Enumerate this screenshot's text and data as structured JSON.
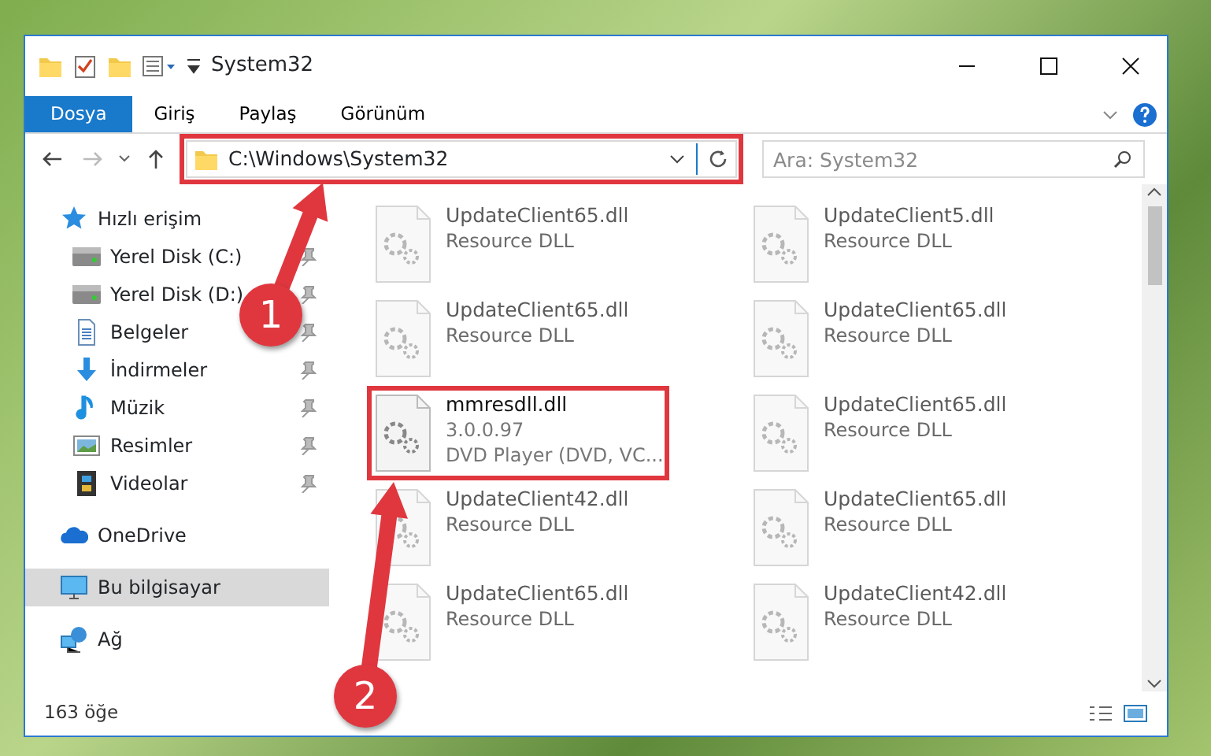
{
  "window": {
    "title": "System32"
  },
  "ribbon_tabs": [
    {
      "label": "Dosya",
      "selected": true
    },
    {
      "label": "Giriş",
      "selected": false
    },
    {
      "label": "Paylaş",
      "selected": false
    },
    {
      "label": "Görünüm",
      "selected": false
    }
  ],
  "address": {
    "path": "C:\\Windows\\System32"
  },
  "search": {
    "placeholder": "Ara: System32"
  },
  "sidebar": {
    "items": [
      {
        "label": "Hızlı erişim",
        "kind": "star",
        "selected": false,
        "children": [
          {
            "label": "Yerel Disk (C:)",
            "kind": "drive",
            "pinned": true
          },
          {
            "label": "Yerel Disk (D:)",
            "kind": "drive",
            "pinned": true
          },
          {
            "label": "Belgeler",
            "kind": "doc",
            "pinned": true
          },
          {
            "label": "İndirmeler",
            "kind": "download",
            "pinned": true
          },
          {
            "label": "Müzik",
            "kind": "music",
            "pinned": true
          },
          {
            "label": "Resimler",
            "kind": "picture",
            "pinned": true
          },
          {
            "label": "Videolar",
            "kind": "video",
            "pinned": true
          }
        ]
      },
      {
        "label": "OneDrive",
        "kind": "cloud",
        "selected": false
      },
      {
        "label": "Bu bilgisayar",
        "kind": "pc",
        "selected": true
      },
      {
        "label": "Ağ",
        "kind": "network",
        "selected": false
      }
    ]
  },
  "files": [
    {
      "name": "UpdateClient65.dll",
      "details": [
        "Resource DLL"
      ],
      "blurred": true
    },
    {
      "name": "UpdateClient5.dll",
      "details": [
        "Resource DLL"
      ],
      "blurred": true
    },
    {
      "name": "UpdateClient65.dll",
      "details": [
        "Resource DLL"
      ],
      "blurred": true
    },
    {
      "name": "UpdateClient65.dll",
      "details": [
        "Resource DLL"
      ],
      "blurred": true
    },
    {
      "name": "mmresdll.dll",
      "details": [
        "3.0.0.97",
        "DVD Player (DVD, VC..."
      ],
      "blurred": false
    },
    {
      "name": "UpdateClient65.dll",
      "details": [
        "Resource DLL"
      ],
      "blurred": true
    },
    {
      "name": "UpdateClient42.dll",
      "details": [
        "Resource DLL"
      ],
      "blurred": true
    },
    {
      "name": "UpdateClient65.dll",
      "details": [
        "Resource DLL"
      ],
      "blurred": true
    },
    {
      "name": "UpdateClient65.dll",
      "details": [
        "Resource DLL"
      ],
      "blurred": true
    },
    {
      "name": "UpdateClient42.dll",
      "details": [
        "Resource DLL"
      ],
      "blurred": true
    }
  ],
  "status_bar": {
    "count": "163 öğe"
  },
  "annotations": [
    {
      "label": "1"
    },
    {
      "label": "2"
    }
  ]
}
